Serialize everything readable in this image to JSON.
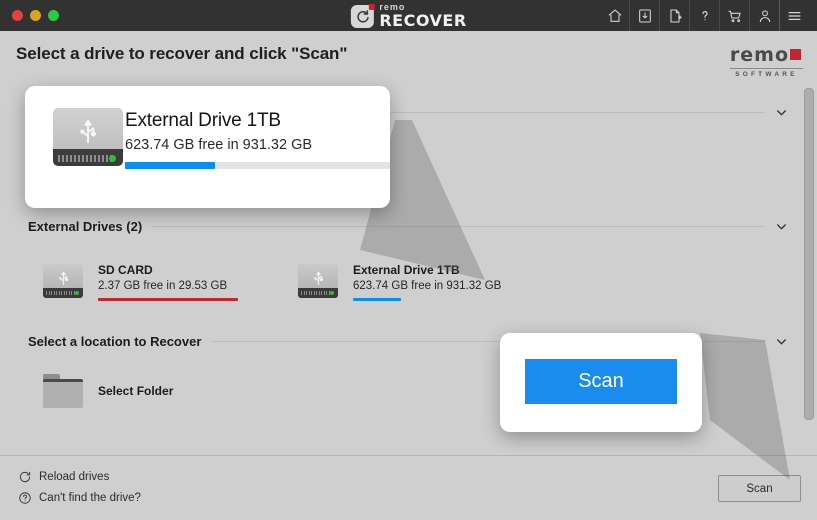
{
  "window": {
    "traffic_lights": [
      "close",
      "minimize",
      "maximize"
    ],
    "brand_small": "remo",
    "brand_large": "RECOVER",
    "toolbar_icons": [
      "home-icon",
      "save-icon",
      "new-file-icon",
      "help-icon",
      "cart-icon",
      "account-icon",
      "menu-icon"
    ]
  },
  "header": {
    "title": "Select a drive to recover and click \"Scan\"",
    "logo_name": "remo",
    "logo_tagline": "SOFTWARE"
  },
  "sections": [
    {
      "label": "External Drives (2)",
      "chevron": "chevron-down-icon"
    },
    {
      "label": "Select a location to Recover",
      "chevron": "chevron-down-icon"
    }
  ],
  "drives": [
    {
      "name": "SD CARD",
      "capacity_text": "2.37 GB free in 29.53 GB",
      "free_gb": 2.37,
      "total_gb": 29.53,
      "used_percent": 92,
      "bar_color": "#c0272d",
      "icon": "usb-drive-icon"
    },
    {
      "name": "External Drive 1TB",
      "capacity_text": "623.74 GB free in 931.32 GB",
      "free_gb": 623.74,
      "total_gb": 931.32,
      "used_percent": 34,
      "bar_color": "#0a8ef0",
      "icon": "usb-drive-icon"
    }
  ],
  "location": {
    "folder_label": "Select Folder",
    "icon": "folder-icon"
  },
  "callout_drive": {
    "name": "External Drive 1TB",
    "capacity_text": "623.74 GB free in 931.32 GB",
    "bar_percent": 34,
    "bar_color": "#0a8ef0"
  },
  "callout_scan": {
    "label": "Scan",
    "color": "#1a8cf0"
  },
  "footer": {
    "reload_label": "Reload drives",
    "reload_icon": "refresh-icon",
    "help_label": "Can't find the drive?",
    "help_icon": "question-circle-icon",
    "scan_label": "Scan"
  }
}
